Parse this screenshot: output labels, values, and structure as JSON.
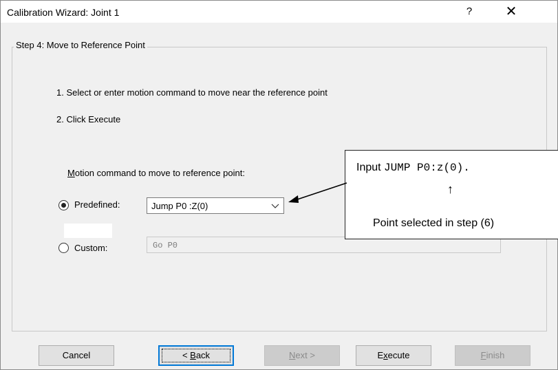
{
  "window": {
    "title": "Calibration Wizard: Joint 1",
    "help_label": "?",
    "close_label": "✕"
  },
  "step": {
    "legend": "Step 4: Move to Reference Point",
    "instruction_1": "1. Select or enter motion command to move near the reference point",
    "instruction_2": "2. Click Execute"
  },
  "motion": {
    "label_mnemonic": "M",
    "label_rest": "otion command to move to reference point:",
    "predefined_label": "Predefined:",
    "predefined_checked": true,
    "predefined_value": "Jump P0 :Z(0)",
    "custom_label": "Custom:",
    "custom_checked": false,
    "custom_value": "Go P0"
  },
  "callout": {
    "prefix": "Input ",
    "code": "JUMP P0:z(0).",
    "arrow": "↑",
    "note": "Point selected in step (6)"
  },
  "buttons": {
    "cancel": "Cancel",
    "back_prefix": "< ",
    "back_mnemonic": "B",
    "back_rest": "ack",
    "next_mnemonic": "N",
    "next_rest": "ext >",
    "execute_prefix": "E",
    "execute_mnemonic": "x",
    "execute_rest": "ecute",
    "finish_mnemonic": "F",
    "finish_rest": "inish"
  },
  "colors": {
    "focus_border": "#0078d7",
    "dialog_bg": "#f0f0f0"
  }
}
